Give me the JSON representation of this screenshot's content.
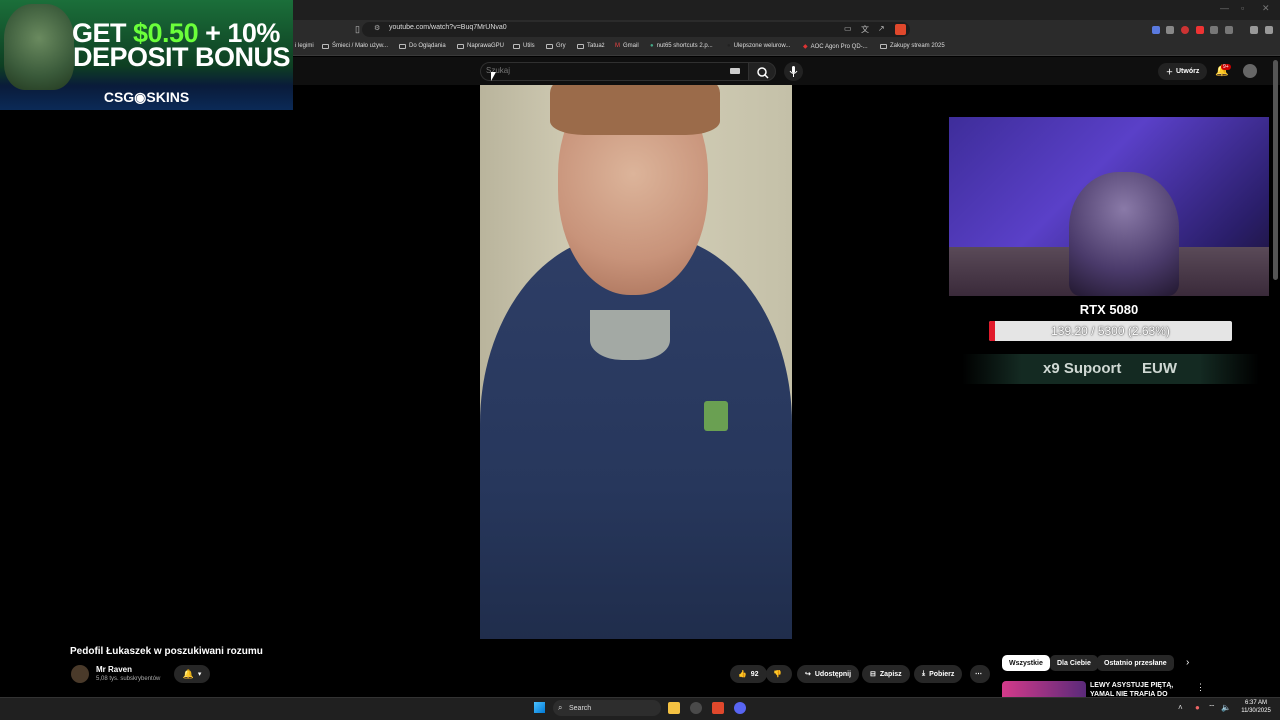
{
  "browser": {
    "url": "youtube.com/watch?v=Buq7MrUNva0",
    "bookmarks": [
      {
        "label": "i legimi"
      },
      {
        "label": "Śmieci / Mało używ..."
      },
      {
        "label": "Do Oglądania"
      },
      {
        "label": "NaprawaGPU"
      },
      {
        "label": "Utils"
      },
      {
        "label": "Gry"
      },
      {
        "label": "Tatuaż"
      },
      {
        "label": "Gmail"
      },
      {
        "label": "nut65 shortcuts 2.p..."
      },
      {
        "label": "Ulepszone welurow..."
      },
      {
        "label": "AOC Agon Pro QD-..."
      },
      {
        "label": "Zakupy stream 2025"
      }
    ]
  },
  "youtube": {
    "search_placeholder": "Szukaj",
    "create_label": "Utwórz",
    "notif_count": "9+",
    "video_title": "Pedofil Łukaszek w poszukiwani rozumu",
    "channel_name": "Mr Raven",
    "channel_subs": "5,08 tys. subskrybentów",
    "likes": "92",
    "share_label": "Udostępnij",
    "save_label": "Zapisz",
    "download_label": "Pobierz",
    "chips": [
      "Wszystkie",
      "Dla Ciebie",
      "Ostatnio przesłane"
    ],
    "rec_title": "LEWY ASYSTUJE PIĘTĄ, YAMAL NIE TRAFIA DO"
  },
  "ad": {
    "line1_a": "GET ",
    "line1_b": "$0.50",
    "line1_c": " + 10%",
    "line2": "DEPOSIT BONUS",
    "brand": "CSG◉SKINS"
  },
  "overlay": {
    "goal_title": "RTX 5080",
    "goal_text": "139.20 / 5300 (2.63%)",
    "goal_progress": 0.0263,
    "rank": "x9 Supoort",
    "region": "EUW"
  },
  "taskbar": {
    "search_label": "Search",
    "time": "6:37 AM",
    "date": "11/30/2025"
  },
  "colors": {
    "youtube_bg": "#0f0f0f",
    "goal_fill": "#e11a2b",
    "ad_green": "#6bff3a"
  }
}
